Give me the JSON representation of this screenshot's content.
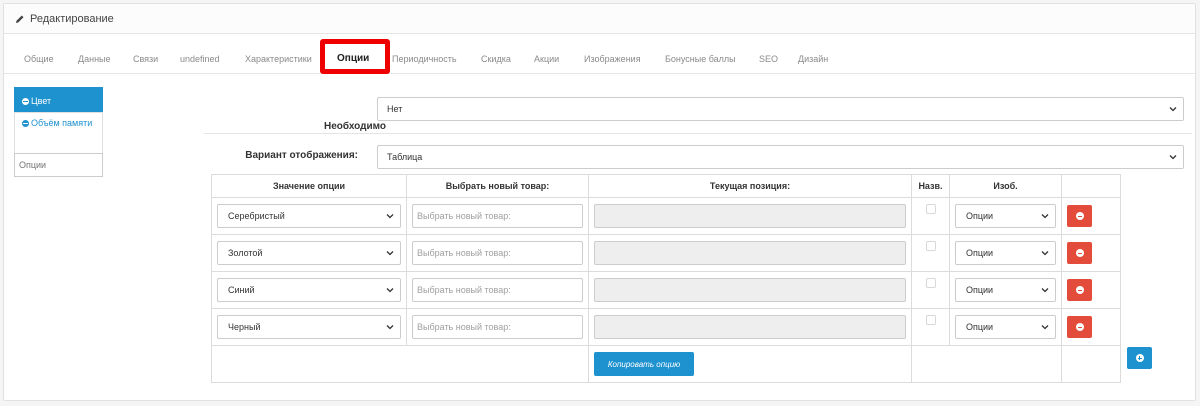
{
  "header": {
    "title": "Редактирование",
    "icon": "pencil-icon"
  },
  "tabs": [
    {
      "label": "Общие",
      "active": false
    },
    {
      "label": "Данные",
      "active": false
    },
    {
      "label": "Связи",
      "active": false
    },
    {
      "label": "undefined",
      "active": false
    },
    {
      "label": "Характеристики",
      "active": false
    },
    {
      "label": "Опции",
      "active": true
    },
    {
      "label": "Периодичность",
      "active": false
    },
    {
      "label": "Скидка",
      "active": false
    },
    {
      "label": "Акции",
      "active": false
    },
    {
      "label": "Изображения",
      "active": false
    },
    {
      "label": "Бонусные баллы",
      "active": false
    },
    {
      "label": "SEO",
      "active": false
    },
    {
      "label": "Дизайн",
      "active": false
    }
  ],
  "option_list": {
    "items": [
      {
        "label": "Цвет",
        "active": true
      },
      {
        "label": "Объём памяти",
        "active": false
      }
    ],
    "input_placeholder": "Опции"
  },
  "form": {
    "required_label": "Необходимо",
    "required_value": "Нет",
    "display_label": "Вариант отображения:",
    "display_value": "Таблица"
  },
  "table": {
    "headers": [
      "Значение опции",
      "Выбрать новый товар:",
      "Текущая позиция:",
      "Назв.",
      "Изоб.",
      ""
    ],
    "rows": [
      {
        "value": "Серебристый",
        "new_product_placeholder": "Выбрать новый товар:",
        "current": "",
        "image_select": "Опции"
      },
      {
        "value": "Золотой",
        "new_product_placeholder": "Выбрать новый товар:",
        "current": "",
        "image_select": "Опции"
      },
      {
        "value": "Синий",
        "new_product_placeholder": "Выбрать новый товар:",
        "current": "",
        "image_select": "Опции"
      },
      {
        "value": "Черный",
        "new_product_placeholder": "Выбрать новый товар:",
        "current": "",
        "image_select": "Опции"
      }
    ],
    "copy_button": "Копировать опцию"
  },
  "colors": {
    "accent": "#1e91cf",
    "danger": "#e34c3a",
    "highlight": "#ee0000"
  }
}
